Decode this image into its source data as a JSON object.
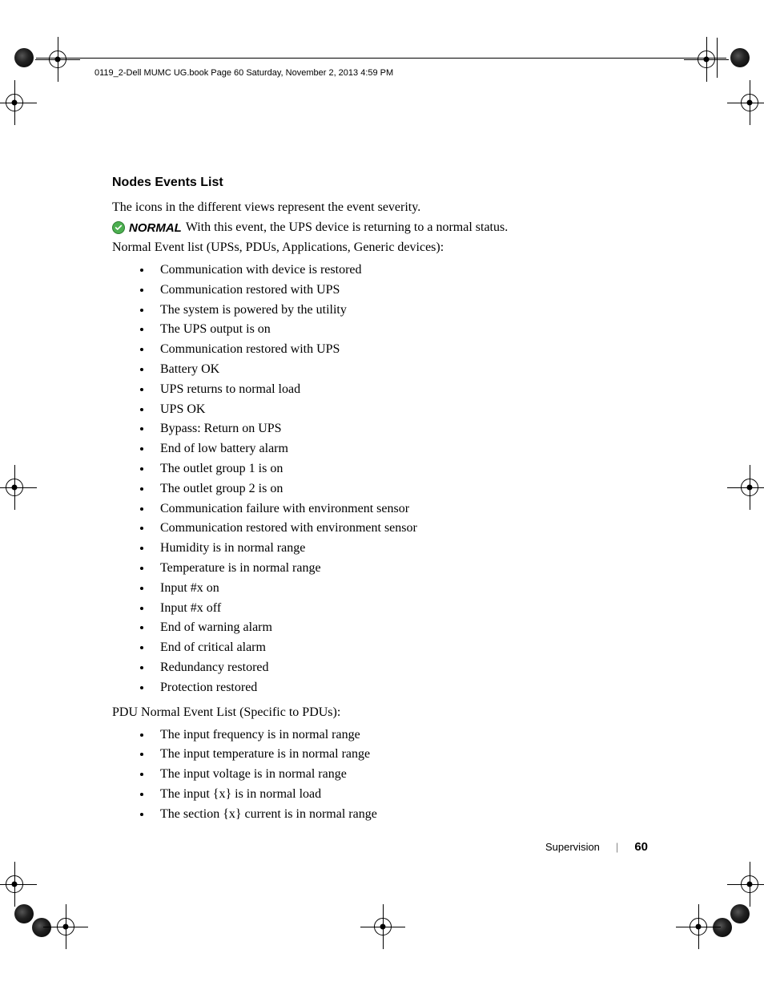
{
  "header": "0119_2-Dell MUMC UG.book  Page 60  Saturday, November 2, 2013  4:59 PM",
  "section_title": "Nodes Events List",
  "intro": "The icons in the different views represent the event severity.",
  "normal_label": "NORMAL",
  "normal_text": " With this event, the UPS device is returning to a normal status.",
  "normal_list_heading": "Normal Event list (UPSs, PDUs, Applications, Generic devices):",
  "normal_events": [
    "Communication with device is restored",
    "Communication restored with UPS",
    "The system is powered by the utility",
    "The UPS output is on",
    "Communication restored with UPS",
    "Battery OK",
    "UPS returns to normal load",
    "UPS OK",
    "Bypass: Return on UPS",
    "End of low battery alarm",
    "The outlet group 1 is on",
    "The outlet group 2 is on",
    "Communication failure with environment sensor",
    "Communication restored with environment sensor",
    "Humidity is in normal range",
    "Temperature is in normal range",
    "Input #x on",
    "Input #x off",
    "End of warning alarm",
    "End of critical alarm",
    "Redundancy restored",
    "Protection restored"
  ],
  "pdu_list_heading": "PDU Normal Event List (Specific to PDUs):",
  "pdu_events": [
    "The input frequency is in normal range",
    "The input temperature is in normal range",
    "The input voltage is in normal range",
    "The input {x} is in normal load",
    "The section {x} current is in normal range"
  ],
  "footer": {
    "section": "Supervision",
    "page": "60"
  }
}
